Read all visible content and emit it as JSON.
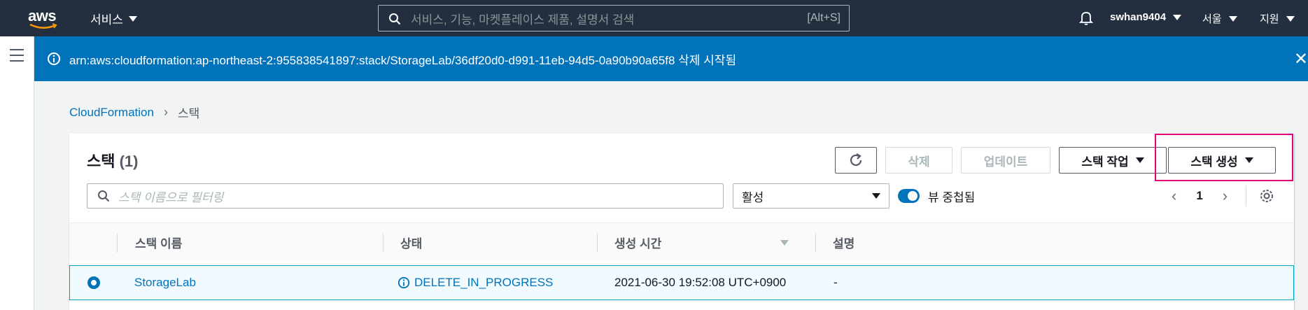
{
  "nav": {
    "logo_text": "aws",
    "services_label": "서비스",
    "search_placeholder": "서비스, 기능, 마켓플레이스 제품, 설명서 검색",
    "search_shortcut": "[Alt+S]",
    "user": "swhan9404",
    "region": "서울",
    "support": "지원"
  },
  "flash": {
    "message": "arn:aws:cloudformation:ap-northeast-2:955838541897:stack/StorageLab/36df20d0-d991-11eb-94d5-0a90b90a65f8 삭제 시작됨",
    "close": "✕"
  },
  "breadcrumb": {
    "root": "CloudFormation",
    "separator": "›",
    "current": "스택"
  },
  "panel": {
    "title": "스택",
    "count": "(1)",
    "delete_label": "삭제",
    "update_label": "업데이트",
    "stack_actions_label": "스택 작업",
    "create_stack_label": "스택 생성",
    "filter_placeholder": "스택 이름으로 필터링",
    "status_filter": "활성",
    "nested_toggle_label": "뷰 중첩됨",
    "page": "1",
    "prev": "‹",
    "next": "›"
  },
  "table": {
    "headers": {
      "name": "스택 이름",
      "status": "상태",
      "created": "생성 시간",
      "description": "설명"
    },
    "rows": [
      {
        "name": "StorageLab",
        "status": "DELETE_IN_PROGRESS",
        "created": "2021-06-30 19:52:08 UTC+0900",
        "description": "-"
      }
    ]
  },
  "colors": {
    "nav_bg": "#232f3e",
    "flash_bg": "#0073bb",
    "link": "#0073bb",
    "highlight": "#e6007e"
  }
}
